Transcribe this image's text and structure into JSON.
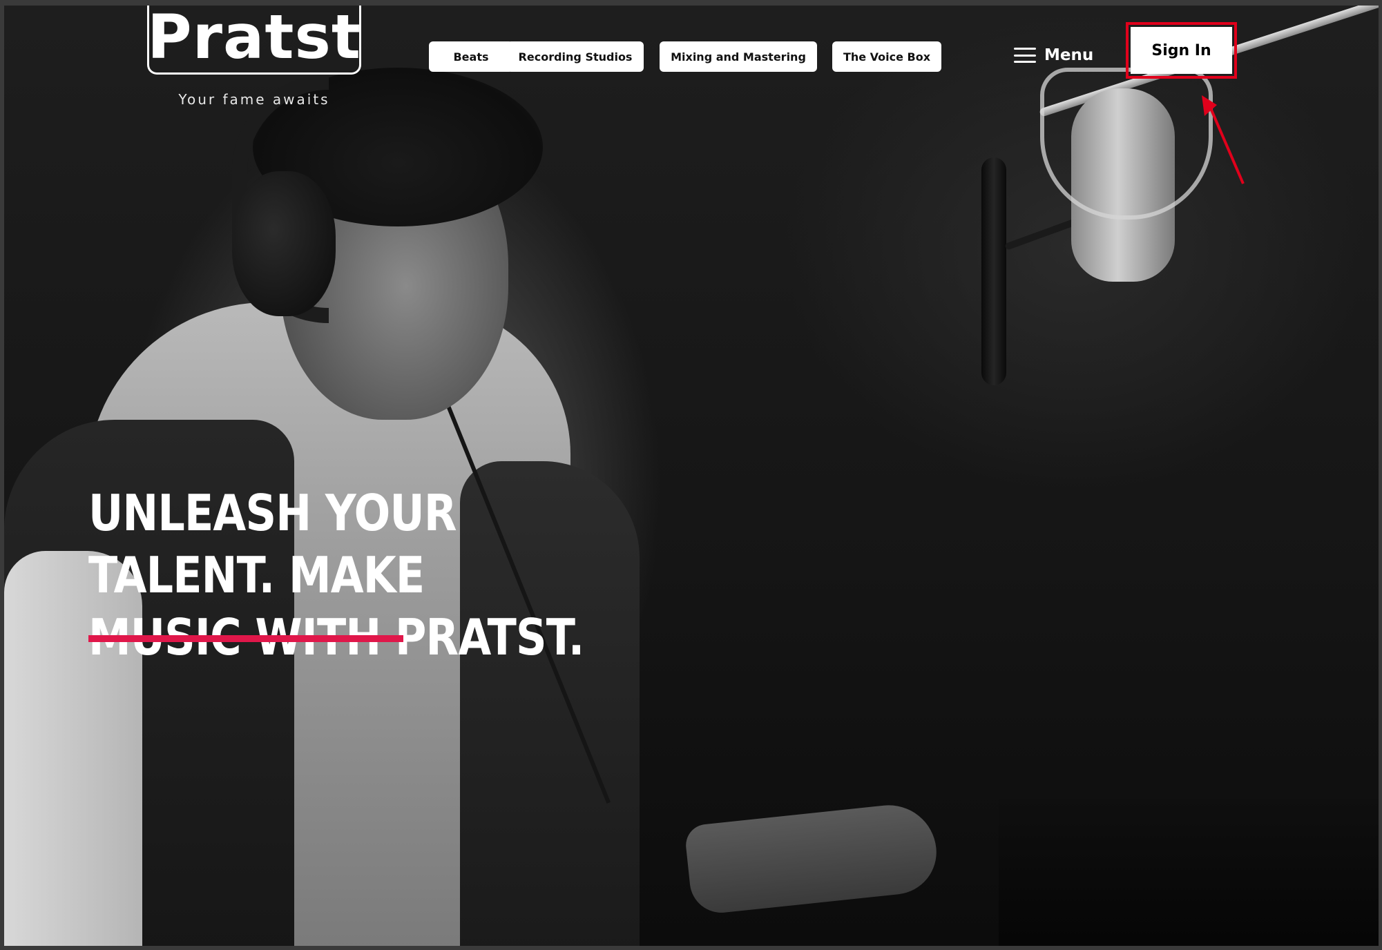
{
  "brand": {
    "name": "Pratst",
    "tagline": "Your fame awaits"
  },
  "nav": {
    "items": [
      {
        "label": "Beats"
      },
      {
        "label": "Recording Studios"
      },
      {
        "label": "Mixing and Mastering"
      },
      {
        "label": "The Voice Box"
      }
    ],
    "menu_label": "Menu",
    "signin_label": "Sign In"
  },
  "hero": {
    "line1": "UNLEASH YOUR TALENT. MAKE",
    "line2": "MUSIC WITH PRATST."
  },
  "colors": {
    "accent": "#e0174a",
    "highlight": "#e0001b",
    "text": "#ffffff",
    "background": "#111111"
  },
  "icons": {
    "menu": "hamburger-icon",
    "annotation": "red-arrow-icon"
  }
}
